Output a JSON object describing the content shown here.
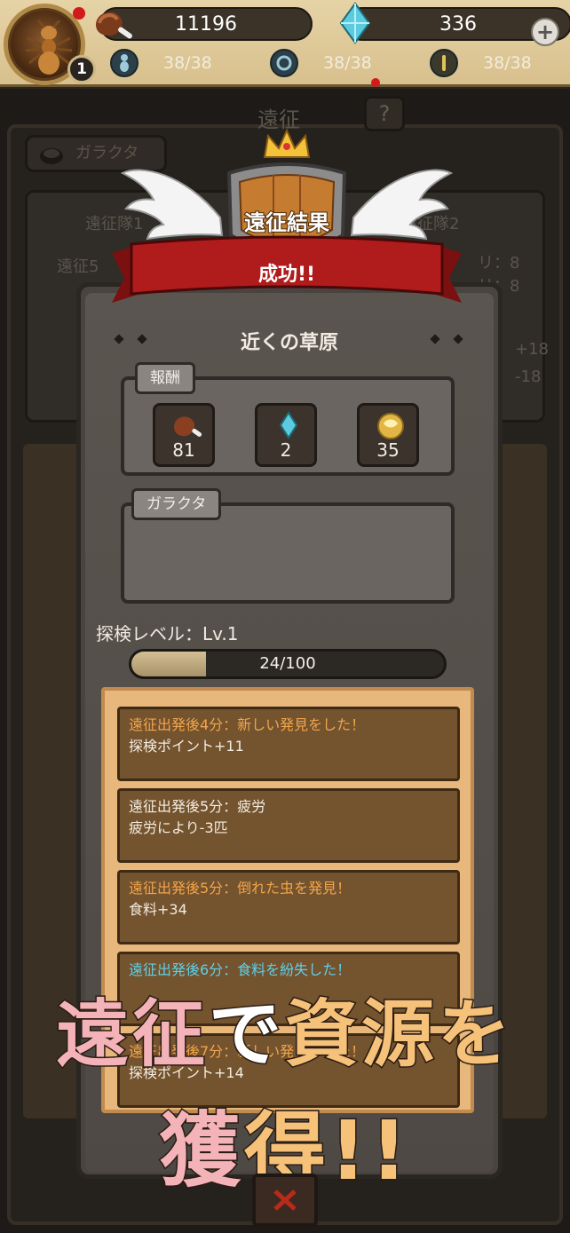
{
  "header": {
    "food_value": "11196",
    "gem_value": "336",
    "player_level": "1",
    "stats": [
      {
        "icon": "ant-worker-icon",
        "value": "38/38"
      },
      {
        "icon": "ant-soldier-icon",
        "value": "38/38"
      },
      {
        "icon": "ant-scout-icon",
        "value": "38/38"
      }
    ]
  },
  "background": {
    "title": "遠征",
    "tab_label": "ガラクタ",
    "texts": [
      "遠征隊1",
      "遠征隊2",
      "遠征5",
      "リ：8",
      "リ：8",
      "+18",
      "-18"
    ]
  },
  "banner": {
    "shield_text": "遠征結果",
    "ribbon_text": "成功!!"
  },
  "dialog": {
    "location": "近くの草原",
    "rewards_label": "報酬",
    "rewards": [
      {
        "icon": "meat-icon",
        "value": "81"
      },
      {
        "icon": "gem-icon",
        "value": "2"
      },
      {
        "icon": "honey-icon",
        "value": "35"
      }
    ],
    "junk_label": "ガラクタ",
    "exploration_level_label": "探検レベル：Lv.1",
    "progress": {
      "text": "24/100",
      "current": 24,
      "max": 100
    },
    "log": [
      {
        "title": "遠征出発後4分：新しい発見をした！",
        "detail": "探検ポイント+11",
        "title_color": "#f2a54a"
      },
      {
        "title": "遠征出発後5分：疲労",
        "detail": "疲労により-3匹",
        "title_color": "#f3ece0"
      },
      {
        "title": "遠征出発後5分：倒れた虫を発見！",
        "detail": "食料+34",
        "title_color": "#f2a54a"
      },
      {
        "title": "遠征出発後6分：食料を紛失した！",
        "detail": "",
        "title_color": "#5fd0e8"
      },
      {
        "title": "遠征出発後7分：新しい発見をした！",
        "detail": "探検ポイント+14",
        "title_color": "#f2a54a"
      }
    ]
  },
  "promo": {
    "line1_a": "遠征",
    "line1_b": "で",
    "line1_c": "資源を",
    "line2_a": "獲",
    "line2_b": "得!!"
  },
  "colors": {
    "accent_orange": "#f2a54a",
    "accent_cyan": "#5fd0e8",
    "ribbon_red": "#a01818"
  }
}
